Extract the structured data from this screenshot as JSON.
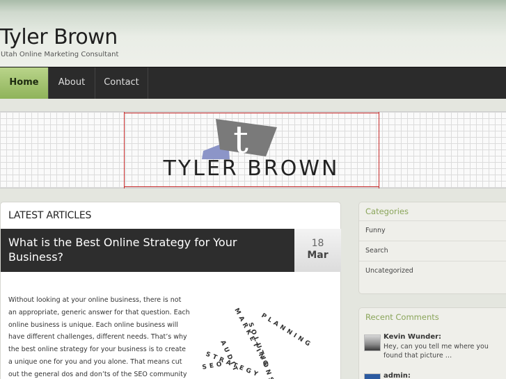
{
  "header": {
    "site_title": "Tyler Brown",
    "tagline": "Utah Online Marketing Consultant"
  },
  "nav": {
    "items": [
      {
        "label": "Home",
        "active": true
      },
      {
        "label": "About",
        "active": false
      },
      {
        "label": "Contact",
        "active": false
      }
    ]
  },
  "banner": {
    "logo_letter": "t",
    "name": "TYLER BROWN"
  },
  "main": {
    "section_heading": "LATEST ARTICLES",
    "post": {
      "title": "What is the Best Online Strategy for Your Business?",
      "date_day": "18",
      "date_month": "Mar",
      "excerpt": "Without looking at your online business, there is not an appropriate, generic answer for that question. Each online business is unique. Each online business will have different challenges, different needs. That’s why the best online strategy for your business is to create a unique one for you and you alone. That means cut out the general dos and don’ts of the SEO community and",
      "image_words": [
        "MARKETING",
        "STRATEGY",
        "PLANNING",
        "SOLUTIONS",
        "AUDIT",
        "SEO"
      ]
    }
  },
  "sidebar": {
    "categories": {
      "title": "Categories",
      "items": [
        "Funny",
        "Search",
        "Uncategorized"
      ]
    },
    "recent_comments": {
      "title": "Recent Comments",
      "items": [
        {
          "author": "Kevin Wunder:",
          "text": "Hey, can you tell me where you found that picture …"
        },
        {
          "author": "admin:",
          "text": ""
        }
      ]
    }
  },
  "colors": {
    "nav_bg": "#2b2b2b",
    "nav_active": "#a4c270",
    "accent_green": "#8aa55a",
    "banner_red": "#c62828"
  }
}
